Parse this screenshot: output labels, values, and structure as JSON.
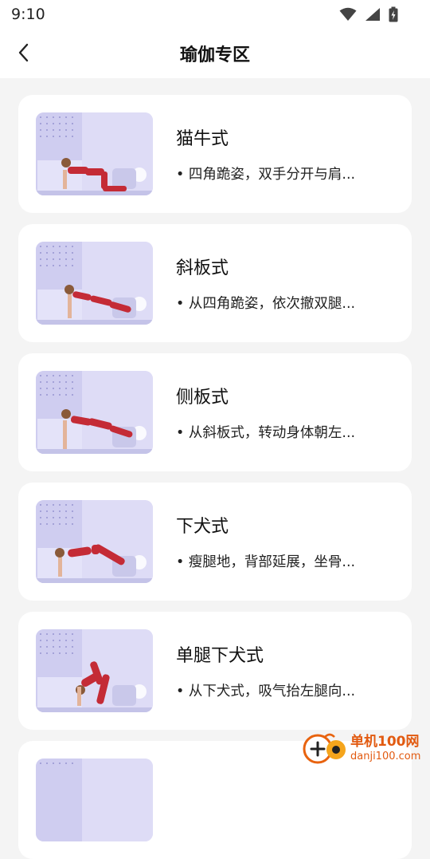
{
  "status": {
    "time": "9:10"
  },
  "header": {
    "title": "瑜伽专区"
  },
  "poses": [
    {
      "title": "猫牛式",
      "desc": "• 四角跪姿，双手分开与肩..."
    },
    {
      "title": "斜板式",
      "desc": "• 从四角跪姿，依次撤双腿..."
    },
    {
      "title": "侧板式",
      "desc": "• 从斜板式，转动身体朝左..."
    },
    {
      "title": "下犬式",
      "desc": "• 瘦腿地，背部延展，坐骨..."
    },
    {
      "title": "单腿下犬式",
      "desc": "• 从下犬式，吸气抬左腿向..."
    },
    {
      "title": "",
      "desc": ""
    }
  ],
  "watermark": {
    "name": "单机100网",
    "url": "danji100.com"
  },
  "colors": {
    "card_bg": "#ffffff",
    "page_bg": "#f4f4f4",
    "thumb_bg": "#dedcf6",
    "outfit": "#c42b36",
    "watermark": "#e25a10"
  },
  "icons": {
    "back": "chevron-left-icon",
    "wifi": "wifi-icon",
    "signal": "cell-signal-icon",
    "battery": "battery-icon"
  }
}
